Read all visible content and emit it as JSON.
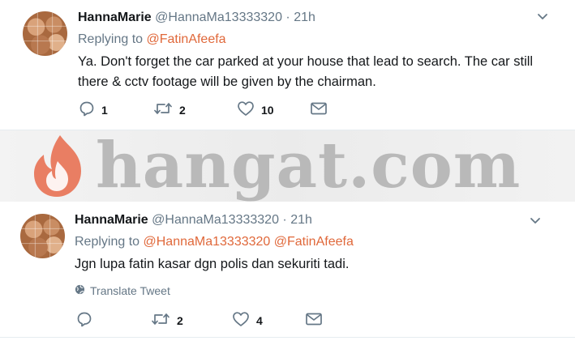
{
  "tweets": [
    {
      "name": "HannaMarie",
      "handle": "@HannaMa13333320",
      "dot": "·",
      "time": "21h",
      "replying_prefix": "Replying to",
      "mentions": [
        "@FatinAfeefa"
      ],
      "text": "Ya. Don't forget the car parked at your house that lead to search. The car still there & cctv footage will be given by the chairman.",
      "reply_count": "1",
      "retweet_count": "2",
      "like_count": "10"
    },
    {
      "name": "HannaMarie",
      "handle": "@HannaMa13333320",
      "dot": "·",
      "time": "21h",
      "replying_prefix": "Replying to",
      "mentions": [
        "@HannaMa13333320",
        "@FatinAfeefa"
      ],
      "text": "Jgn lupa fatin kasar dgn polis dan sekuriti tadi.",
      "translate_label": "Translate Tweet",
      "reply_count": "",
      "retweet_count": "2",
      "like_count": "4"
    }
  ],
  "watermark": {
    "text": "hangat.com"
  },
  "colors": {
    "mention": "#e0683a",
    "muted": "#657786",
    "text": "#14171a",
    "watermark_flame": "#e86a4a"
  },
  "icons": [
    "chevron-down-icon",
    "reply-icon",
    "retweet-icon",
    "heart-icon",
    "envelope-icon",
    "globe-icon",
    "flame-logo-icon"
  ]
}
